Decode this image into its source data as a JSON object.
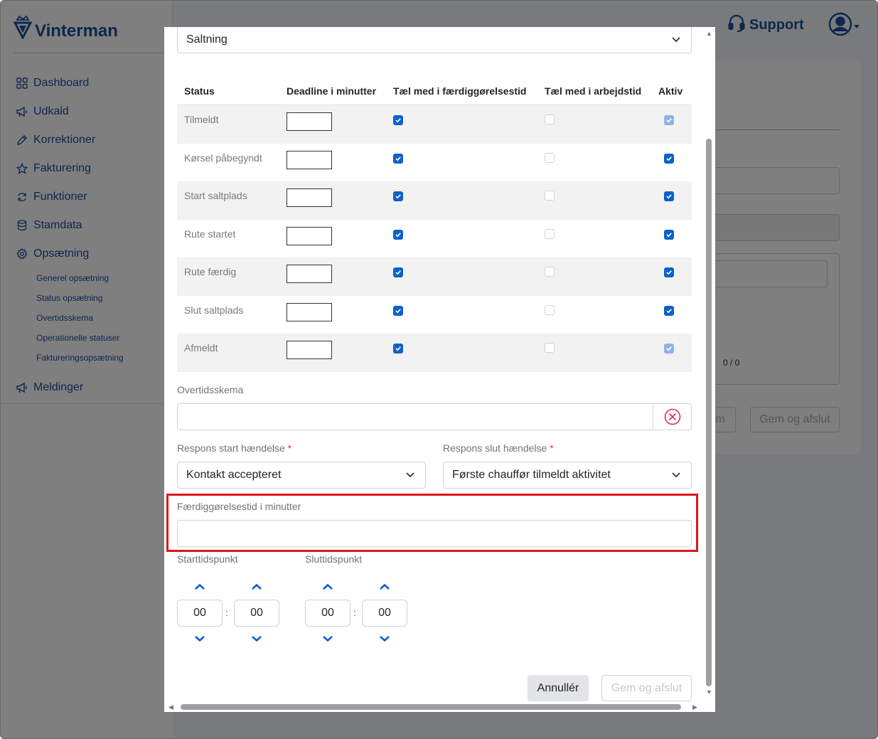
{
  "app": {
    "brand": "Vinterman",
    "support_label": "Support"
  },
  "sidebar": {
    "items": [
      {
        "label": "Dashboard",
        "icon": "grid-icon"
      },
      {
        "label": "Udkald",
        "icon": "megaphone-icon"
      },
      {
        "label": "Korrektioner",
        "icon": "pencil-icon"
      },
      {
        "label": "Fakturering",
        "icon": "star-icon"
      },
      {
        "label": "Funktioner",
        "icon": "refresh-icon"
      },
      {
        "label": "Stamdata",
        "icon": "database-icon"
      },
      {
        "label": "Opsætning",
        "icon": "gear-icon"
      }
    ],
    "subitems": [
      "Generel opsætning",
      "Status opsætning",
      "Overtidsskema",
      "Operationelle statuser",
      "Faktureringsopsætning"
    ],
    "last_item": {
      "label": "Meldinger",
      "icon": "megaphone-icon"
    }
  },
  "background": {
    "pager": "0 / 0",
    "btn_partial": "m",
    "btn_save": "Gem og afslut"
  },
  "modal": {
    "type_select": "Saltning",
    "table": {
      "headers": [
        "Status",
        "Deadline i minutter",
        "Tæl med i færdiggørelsestid",
        "Tæl med i arbejdstid",
        "Aktiv"
      ],
      "rows": [
        {
          "status": "Tilmeldt",
          "deadline": "",
          "faerdig": "on",
          "arbejd": "off",
          "aktiv": "dis"
        },
        {
          "status": "Kørsel påbegyndt",
          "deadline": "",
          "faerdig": "on",
          "arbejd": "off",
          "aktiv": "on"
        },
        {
          "status": "Start saltplads",
          "deadline": "",
          "faerdig": "on",
          "arbejd": "off",
          "aktiv": "on"
        },
        {
          "status": "Rute startet",
          "deadline": "",
          "faerdig": "on",
          "arbejd": "off",
          "aktiv": "on"
        },
        {
          "status": "Rute færdig",
          "deadline": "",
          "faerdig": "on",
          "arbejd": "off",
          "aktiv": "on"
        },
        {
          "status": "Slut saltplads",
          "deadline": "",
          "faerdig": "on",
          "arbejd": "off",
          "aktiv": "on"
        },
        {
          "status": "Afmeldt",
          "deadline": "",
          "faerdig": "on",
          "arbejd": "off",
          "aktiv": "dis"
        }
      ]
    },
    "overtid_label": "Overtidsskema",
    "overtid_value": "",
    "respons_start_label": "Respons start hændelse",
    "respons_start_value": "Kontakt accepteret",
    "respons_slut_label": "Respons slut hændelse",
    "respons_slut_value": "Første chauffør tilmeldt aktivitet",
    "required_mark": "*",
    "faerdig_label": "Færdiggørelsestid i minutter",
    "faerdig_value": "",
    "start_label": "Starttidspunkt",
    "slut_label": "Sluttidspunkt",
    "start_hour": "00",
    "start_min": "00",
    "slut_hour": "00",
    "slut_min": "00",
    "time_sep": ":",
    "cancel_label": "Annullér",
    "save_label": "Gem og afslut"
  },
  "colors": {
    "brand": "#1b4f9c",
    "checkbox": "#0b62c9",
    "highlight": "#e0141e",
    "clear_icon": "#dc3545"
  }
}
